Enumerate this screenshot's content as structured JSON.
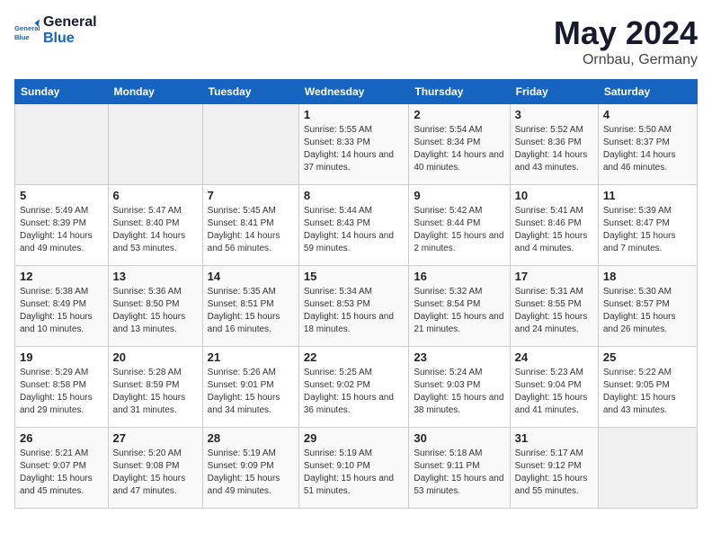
{
  "logo": {
    "line1": "General",
    "line2": "Blue"
  },
  "title": "May 2024",
  "subtitle": "Ornbau, Germany",
  "days_header": [
    "Sunday",
    "Monday",
    "Tuesday",
    "Wednesday",
    "Thursday",
    "Friday",
    "Saturday"
  ],
  "weeks": [
    [
      {
        "day": "",
        "info": ""
      },
      {
        "day": "",
        "info": ""
      },
      {
        "day": "",
        "info": ""
      },
      {
        "day": "1",
        "info": "Sunrise: 5:55 AM\nSunset: 8:33 PM\nDaylight: 14 hours\nand 37 minutes."
      },
      {
        "day": "2",
        "info": "Sunrise: 5:54 AM\nSunset: 8:34 PM\nDaylight: 14 hours\nand 40 minutes."
      },
      {
        "day": "3",
        "info": "Sunrise: 5:52 AM\nSunset: 8:36 PM\nDaylight: 14 hours\nand 43 minutes."
      },
      {
        "day": "4",
        "info": "Sunrise: 5:50 AM\nSunset: 8:37 PM\nDaylight: 14 hours\nand 46 minutes."
      }
    ],
    [
      {
        "day": "5",
        "info": "Sunrise: 5:49 AM\nSunset: 8:39 PM\nDaylight: 14 hours\nand 49 minutes."
      },
      {
        "day": "6",
        "info": "Sunrise: 5:47 AM\nSunset: 8:40 PM\nDaylight: 14 hours\nand 53 minutes."
      },
      {
        "day": "7",
        "info": "Sunrise: 5:45 AM\nSunset: 8:41 PM\nDaylight: 14 hours\nand 56 minutes."
      },
      {
        "day": "8",
        "info": "Sunrise: 5:44 AM\nSunset: 8:43 PM\nDaylight: 14 hours\nand 59 minutes."
      },
      {
        "day": "9",
        "info": "Sunrise: 5:42 AM\nSunset: 8:44 PM\nDaylight: 15 hours\nand 2 minutes."
      },
      {
        "day": "10",
        "info": "Sunrise: 5:41 AM\nSunset: 8:46 PM\nDaylight: 15 hours\nand 4 minutes."
      },
      {
        "day": "11",
        "info": "Sunrise: 5:39 AM\nSunset: 8:47 PM\nDaylight: 15 hours\nand 7 minutes."
      }
    ],
    [
      {
        "day": "12",
        "info": "Sunrise: 5:38 AM\nSunset: 8:49 PM\nDaylight: 15 hours\nand 10 minutes."
      },
      {
        "day": "13",
        "info": "Sunrise: 5:36 AM\nSunset: 8:50 PM\nDaylight: 15 hours\nand 13 minutes."
      },
      {
        "day": "14",
        "info": "Sunrise: 5:35 AM\nSunset: 8:51 PM\nDaylight: 15 hours\nand 16 minutes."
      },
      {
        "day": "15",
        "info": "Sunrise: 5:34 AM\nSunset: 8:53 PM\nDaylight: 15 hours\nand 18 minutes."
      },
      {
        "day": "16",
        "info": "Sunrise: 5:32 AM\nSunset: 8:54 PM\nDaylight: 15 hours\nand 21 minutes."
      },
      {
        "day": "17",
        "info": "Sunrise: 5:31 AM\nSunset: 8:55 PM\nDaylight: 15 hours\nand 24 minutes."
      },
      {
        "day": "18",
        "info": "Sunrise: 5:30 AM\nSunset: 8:57 PM\nDaylight: 15 hours\nand 26 minutes."
      }
    ],
    [
      {
        "day": "19",
        "info": "Sunrise: 5:29 AM\nSunset: 8:58 PM\nDaylight: 15 hours\nand 29 minutes."
      },
      {
        "day": "20",
        "info": "Sunrise: 5:28 AM\nSunset: 8:59 PM\nDaylight: 15 hours\nand 31 minutes."
      },
      {
        "day": "21",
        "info": "Sunrise: 5:26 AM\nSunset: 9:01 PM\nDaylight: 15 hours\nand 34 minutes."
      },
      {
        "day": "22",
        "info": "Sunrise: 5:25 AM\nSunset: 9:02 PM\nDaylight: 15 hours\nand 36 minutes."
      },
      {
        "day": "23",
        "info": "Sunrise: 5:24 AM\nSunset: 9:03 PM\nDaylight: 15 hours\nand 38 minutes."
      },
      {
        "day": "24",
        "info": "Sunrise: 5:23 AM\nSunset: 9:04 PM\nDaylight: 15 hours\nand 41 minutes."
      },
      {
        "day": "25",
        "info": "Sunrise: 5:22 AM\nSunset: 9:05 PM\nDaylight: 15 hours\nand 43 minutes."
      }
    ],
    [
      {
        "day": "26",
        "info": "Sunrise: 5:21 AM\nSunset: 9:07 PM\nDaylight: 15 hours\nand 45 minutes."
      },
      {
        "day": "27",
        "info": "Sunrise: 5:20 AM\nSunset: 9:08 PM\nDaylight: 15 hours\nand 47 minutes."
      },
      {
        "day": "28",
        "info": "Sunrise: 5:19 AM\nSunset: 9:09 PM\nDaylight: 15 hours\nand 49 minutes."
      },
      {
        "day": "29",
        "info": "Sunrise: 5:19 AM\nSunset: 9:10 PM\nDaylight: 15 hours\nand 51 minutes."
      },
      {
        "day": "30",
        "info": "Sunrise: 5:18 AM\nSunset: 9:11 PM\nDaylight: 15 hours\nand 53 minutes."
      },
      {
        "day": "31",
        "info": "Sunrise: 5:17 AM\nSunset: 9:12 PM\nDaylight: 15 hours\nand 55 minutes."
      },
      {
        "day": "",
        "info": ""
      }
    ]
  ]
}
